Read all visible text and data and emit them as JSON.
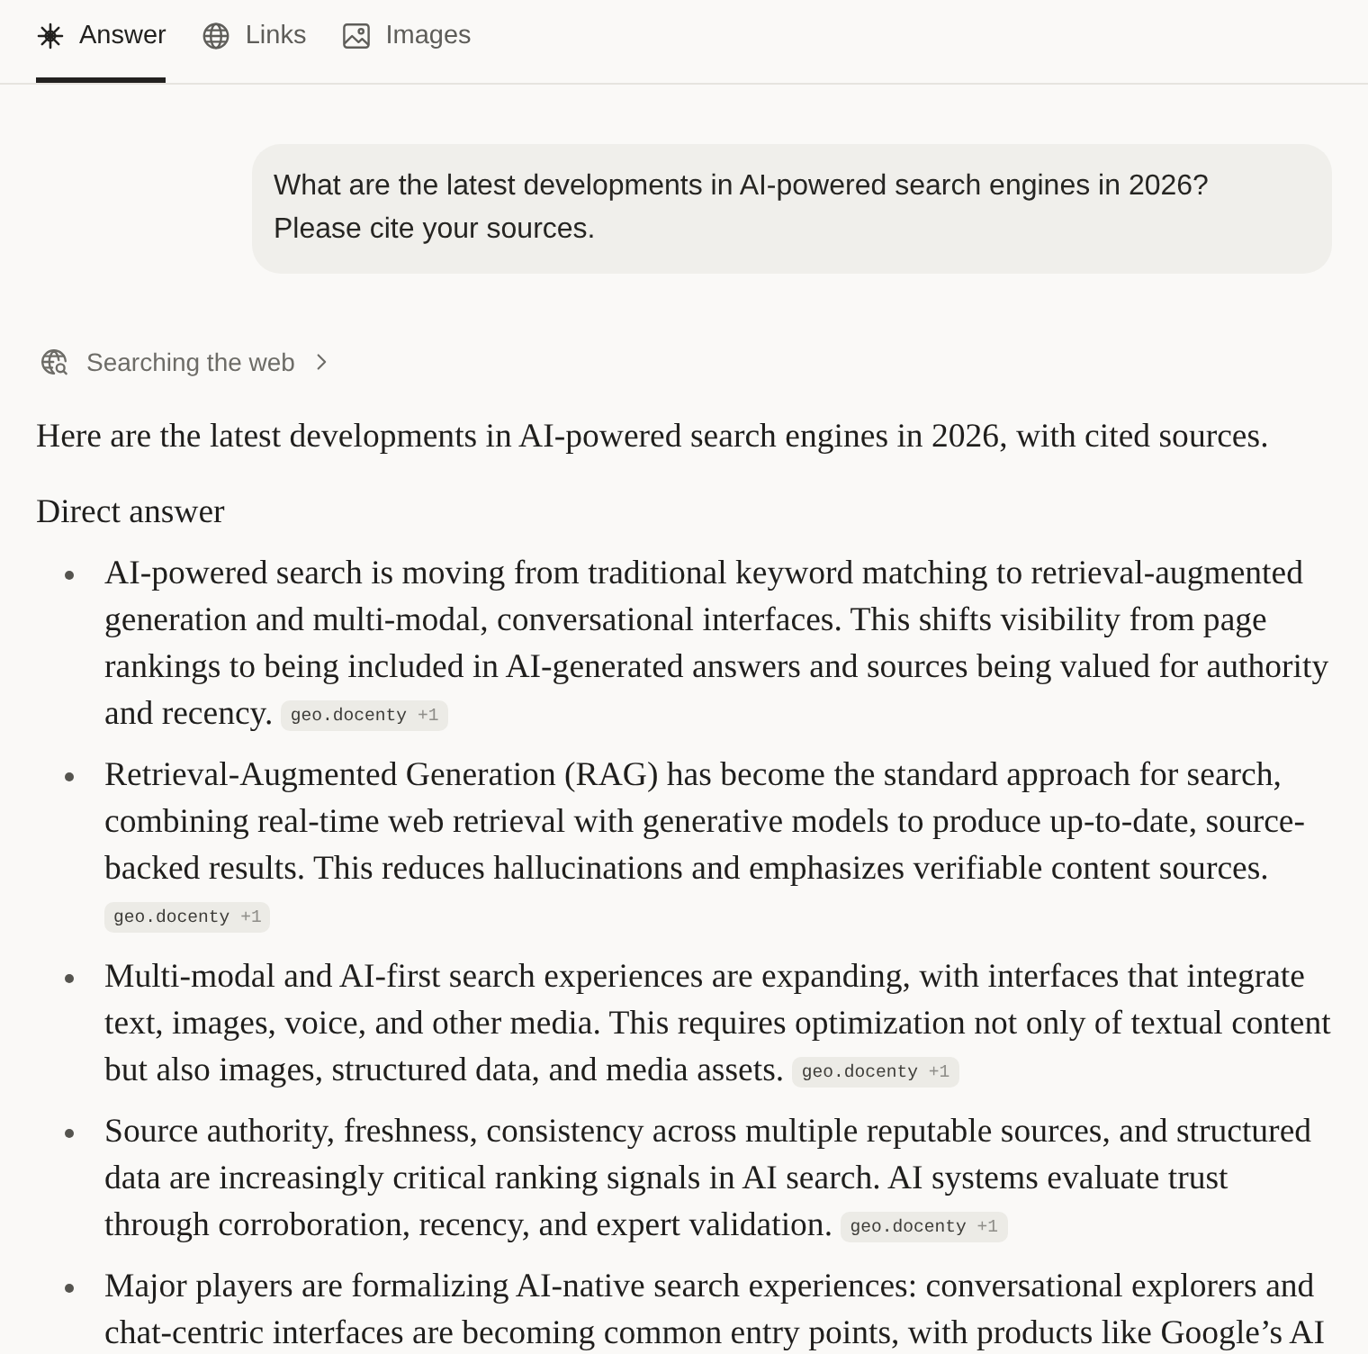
{
  "tabs": [
    {
      "kind": "answer",
      "label": "Answer",
      "selected": true
    },
    {
      "kind": "links",
      "label": "Links",
      "selected": false
    },
    {
      "kind": "images",
      "label": "Images",
      "selected": false
    }
  ],
  "user_message": {
    "text": "What are the latest developments in AI-powered search engines in 2026? Please cite your sources."
  },
  "search_status": {
    "label": "Searching the web"
  },
  "answer": {
    "intro": "Here are the latest developments in AI-powered search engines in 2026, with cited sources.",
    "heading": "Direct answer",
    "bullets": [
      {
        "text": "AI-powered search is moving from traditional keyword matching to retrieval-augmented generation and multi-modal, conversational interfaces. This shifts visibility from page rankings to being included in AI-generated answers and sources being valued for authority and recency.",
        "citations": [
          {
            "source": "geo.docenty",
            "more": "+1"
          }
        ]
      },
      {
        "text": "Retrieval-Augmented Generation (RAG) has become the standard approach for search, combining real-time web retrieval with generative models to produce up-to-date, source-backed results. This reduces hallucinations and emphasizes verifiable content sources.",
        "citations": [
          {
            "source": "geo.docenty",
            "more": "+1"
          }
        ]
      },
      {
        "text": "Multi-modal and AI-first search experiences are expanding, with interfaces that integrate text, images, voice, and other media. This requires optimization not only of textual content but also images, structured data, and media assets.",
        "citations": [
          {
            "source": "geo.docenty",
            "more": "+1"
          }
        ]
      },
      {
        "text": "Source authority, freshness, consistency across multiple reputable sources, and structured data are increasingly critical ranking signals in AI search. AI systems evaluate trust through corroboration, recency, and expert validation.",
        "citations": [
          {
            "source": "geo.docenty",
            "more": "+1"
          }
        ]
      },
      {
        "text": "Major players are formalizing AI-native search experiences: conversational explorers and chat-centric interfaces are becoming common entry points, with products like Google’s AI"
      }
    ]
  }
}
